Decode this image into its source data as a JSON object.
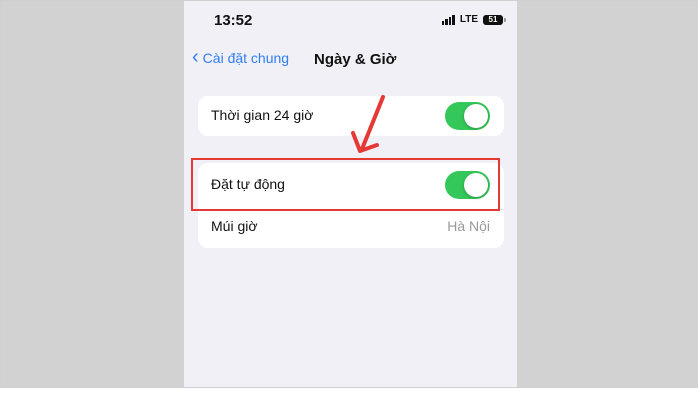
{
  "status_bar": {
    "time": "13:52",
    "network": "LTE",
    "battery": "51",
    "signal_bars": 4
  },
  "nav": {
    "back_label": "Cài đặt chung",
    "title": "Ngày & Giờ"
  },
  "settings": {
    "hour24": {
      "label": "Thời gian 24 giờ",
      "enabled": true
    },
    "auto_set": {
      "label": "Đặt tự động",
      "enabled": true
    },
    "timezone": {
      "label": "Múi giờ",
      "value": "Hà Nội"
    }
  },
  "colors": {
    "toggle_on": "#34c759",
    "link": "#2f7ef6",
    "annotation": "#e53935"
  },
  "icons": [
    "chevron-left-icon",
    "signal-icon",
    "battery-icon"
  ]
}
